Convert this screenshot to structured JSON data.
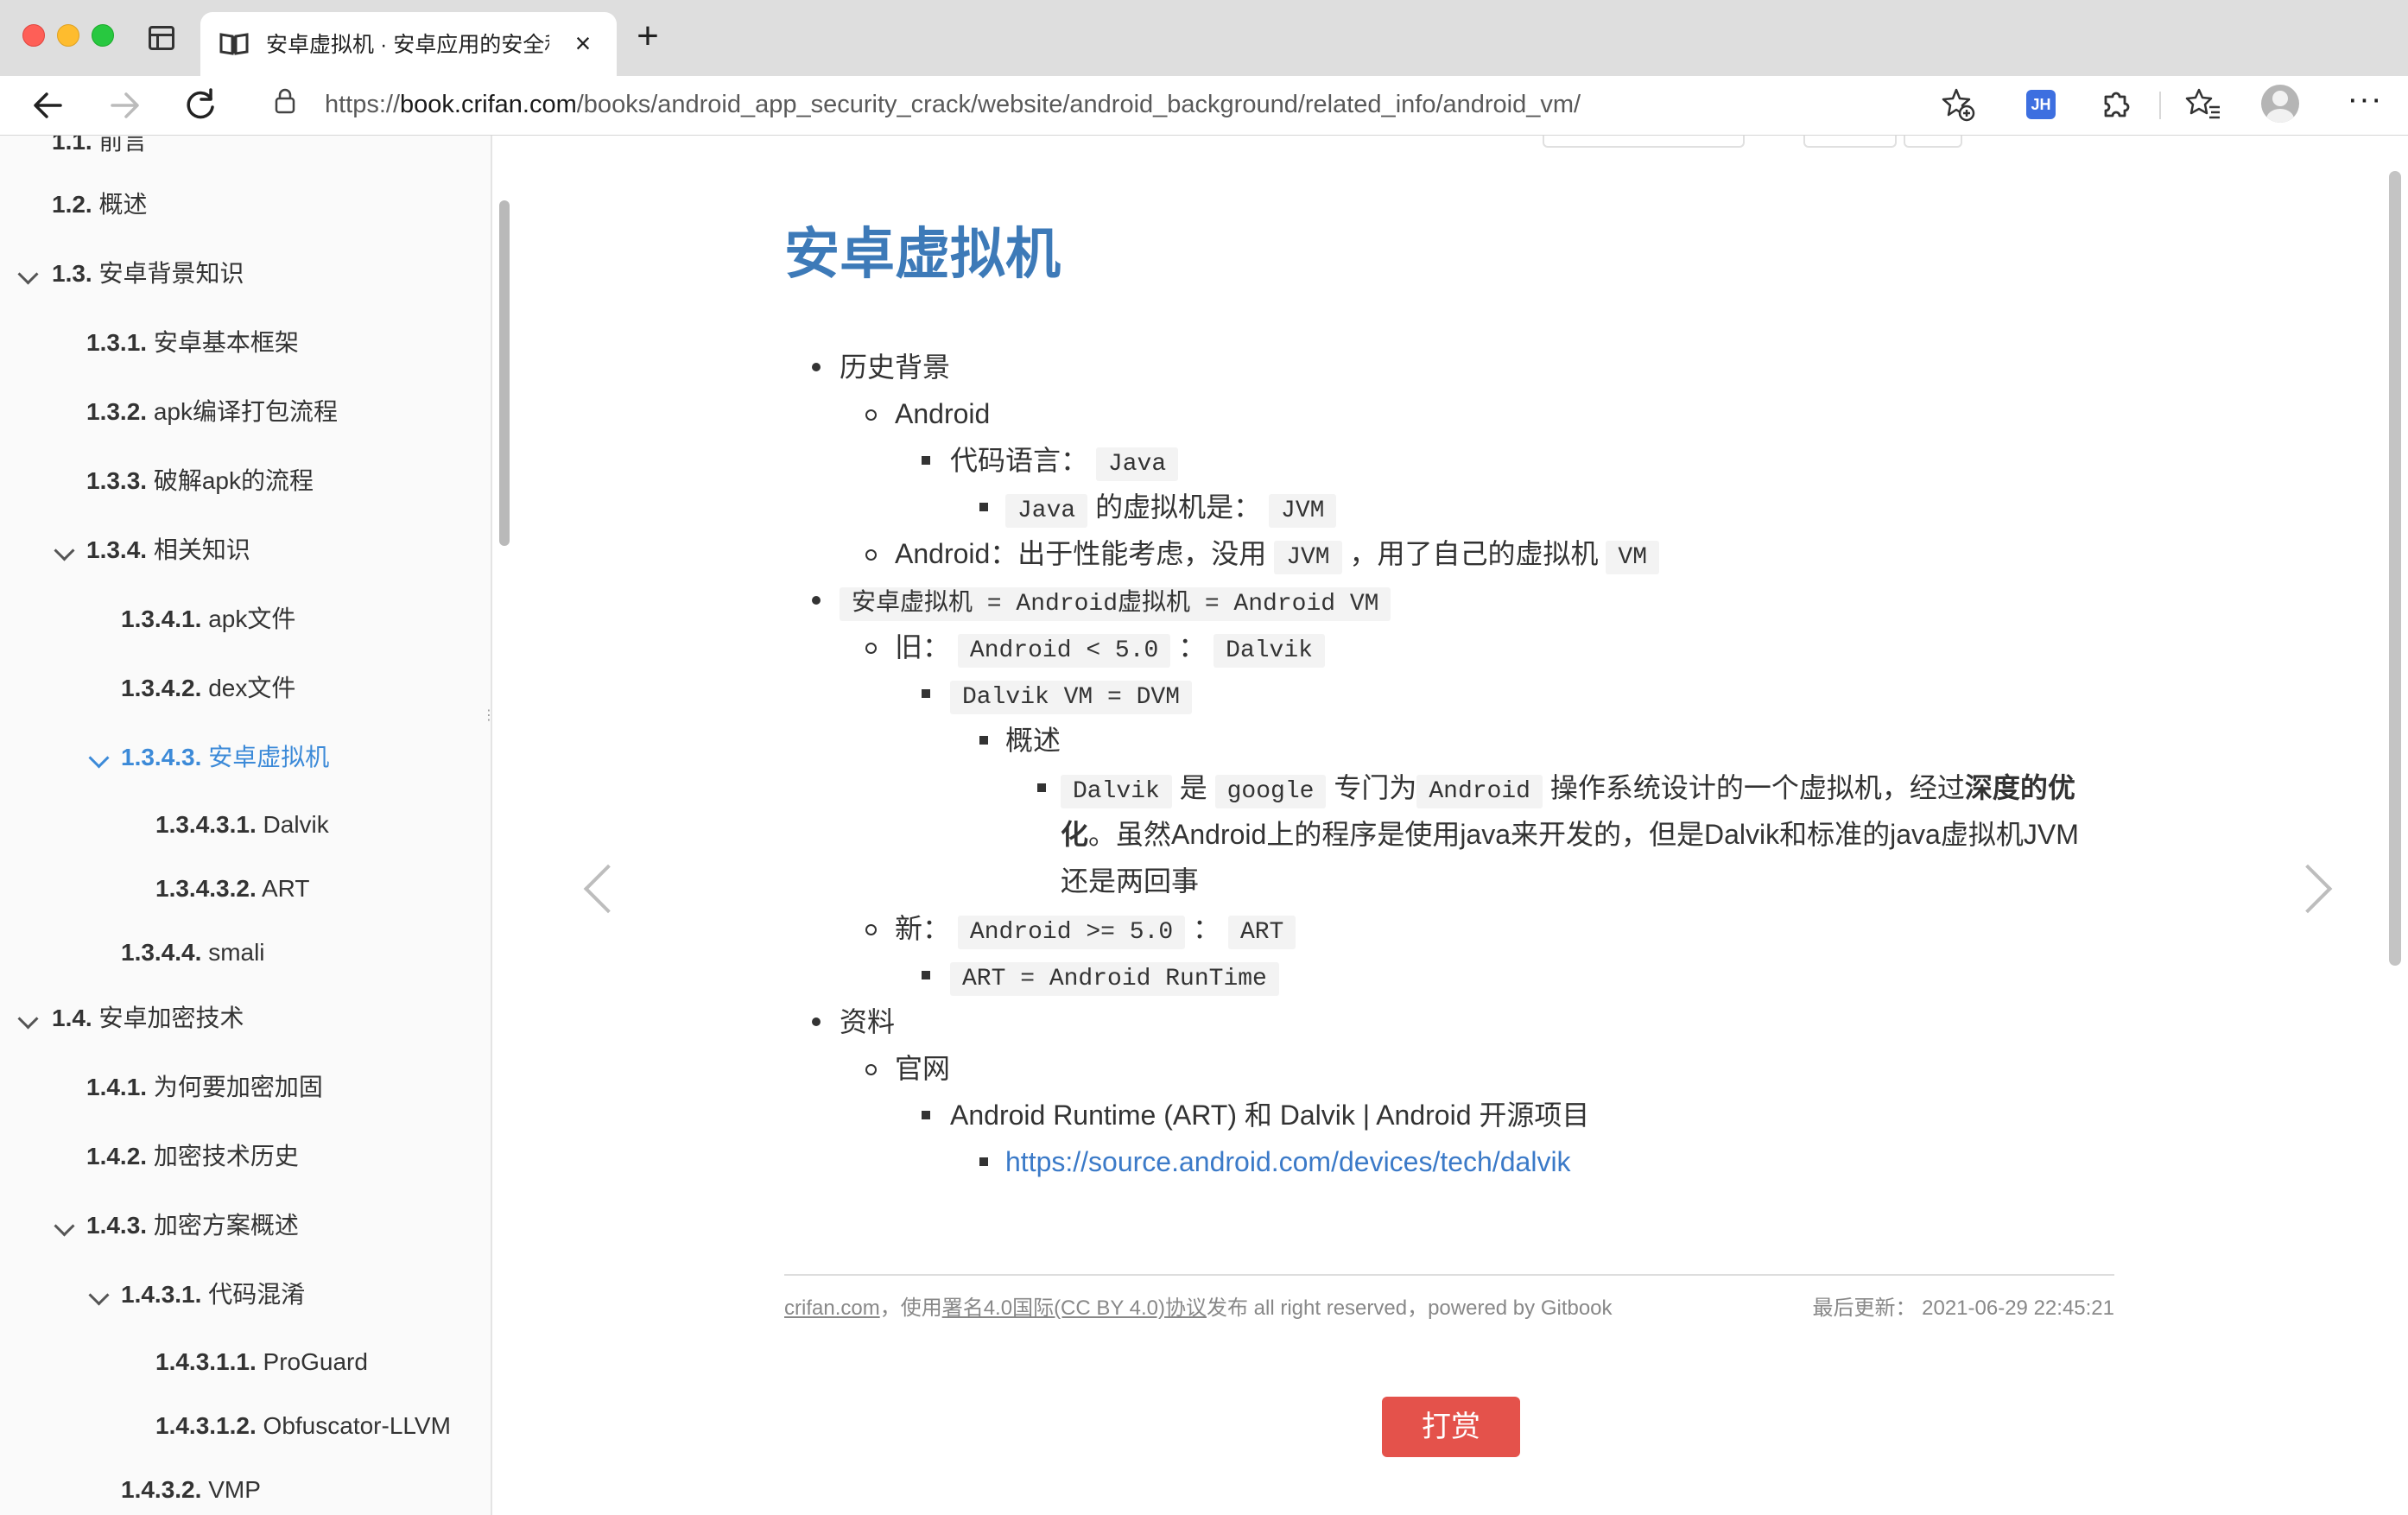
{
  "browser": {
    "tab_title": "安卓虚拟机 · 安卓应用的安全和破解",
    "tab_close": "×",
    "new_tab": "+",
    "url_prefix": "https://",
    "url_host": "book.crifan.com",
    "url_path": "/books/android_app_security_crack/website/android_background/related_info/android_vm/",
    "ext_label": "JH",
    "more": "···",
    "icons": [
      "sidebar-toggle-icon",
      "book-icon",
      "back-arrow-icon",
      "forward-arrow-icon",
      "reload-icon",
      "lock-icon",
      "add-favorite-icon",
      "extensions-icon",
      "favorites-icon",
      "profile-icon",
      "more-icon"
    ]
  },
  "sidebar": {
    "items": [
      {
        "num": "1.1.",
        "label": "前言"
      },
      {
        "num": "1.2.",
        "label": "概述"
      },
      {
        "num": "1.3.",
        "label": "安卓背景知识"
      },
      {
        "num": "1.3.1.",
        "label": "安卓基本框架"
      },
      {
        "num": "1.3.2.",
        "label": "apk编译打包流程"
      },
      {
        "num": "1.3.3.",
        "label": "破解apk的流程"
      },
      {
        "num": "1.3.4.",
        "label": "相关知识"
      },
      {
        "num": "1.3.4.1.",
        "label": "apk文件"
      },
      {
        "num": "1.3.4.2.",
        "label": "dex文件"
      },
      {
        "num": "1.3.4.3.",
        "label": "安卓虚拟机"
      },
      {
        "num": "1.3.4.3.1.",
        "label": "Dalvik"
      },
      {
        "num": "1.3.4.3.2.",
        "label": "ART"
      },
      {
        "num": "1.3.4.4.",
        "label": "smali"
      },
      {
        "num": "1.4.",
        "label": "安卓加密技术"
      },
      {
        "num": "1.4.1.",
        "label": "为何要加密加固"
      },
      {
        "num": "1.4.2.",
        "label": "加密技术历史"
      },
      {
        "num": "1.4.3.",
        "label": "加密方案概述"
      },
      {
        "num": "1.4.3.1.",
        "label": "代码混淆"
      },
      {
        "num": "1.4.3.1.1.",
        "label": "ProGuard"
      },
      {
        "num": "1.4.3.1.2.",
        "label": "Obfuscator-LLVM"
      },
      {
        "num": "1.4.3.2.",
        "label": "VMP"
      }
    ],
    "active_color": "#3c8ad8"
  },
  "content": {
    "title": "安卓虚拟机",
    "t_lishi": "历史背景",
    "t_android": "Android",
    "t_daima": "代码语言：",
    "c_java": "Java",
    "c_java2": "Java",
    "t_de_vm": "的虚拟机是：",
    "c_jvm": "JVM",
    "t_android2": "Android：出于性能考虑，没用",
    "c_jvm2": "JVM",
    "t_yongle": "，用了自己的虚拟机",
    "c_vm": "VM",
    "c_eq": "安卓虚拟机 = Android虚拟机 = Android VM",
    "t_jiu": "旧：",
    "c_old": "Android < 5.0",
    "t_colon1": "：",
    "c_dalvik": "Dalvik",
    "c_dvm": "Dalvik VM = DVM",
    "t_gaishu": "概述",
    "c_dalvik2": "Dalvik",
    "t_shi": "是",
    "c_google": "google",
    "t_zhuanmen": "专门为",
    "c_android": "Android",
    "t_caozuo": "操作系统设计的一个虚拟机，经过",
    "t_bold1": "深度的优",
    "t_bold2": "化",
    "t_line2": "。虽然Android上的程序是使用java来开发的，但是Dalvik和标准的java虚拟机JVM",
    "t_line3": "还是两回事",
    "t_xin": "新：",
    "c_new": "Android >= 5.0",
    "t_colon2": "：",
    "c_art": "ART",
    "c_art_full": "ART = Android RunTime",
    "t_ziliao": "资料",
    "t_guanwang": "官网",
    "t_runtime": "Android Runtime (ART) 和 Dalvik | Android 开源项目",
    "link_dalvik": "https://source.android.com/devices/tech/dalvik"
  },
  "footer": {
    "site": "crifan.com",
    "sep": "，使用",
    "license": "署名4.0国际(CC BY 4.0)协议",
    "rest": "发布 all right reserved，powered by Gitbook",
    "updated_label": "最后更新：",
    "updated_time": "2021-06-29 22:45:21"
  },
  "reward": {
    "label": "打赏"
  },
  "colors": {
    "title": "#3d7ab8",
    "link": "#3b7ac8",
    "reward": "#e4524b"
  }
}
